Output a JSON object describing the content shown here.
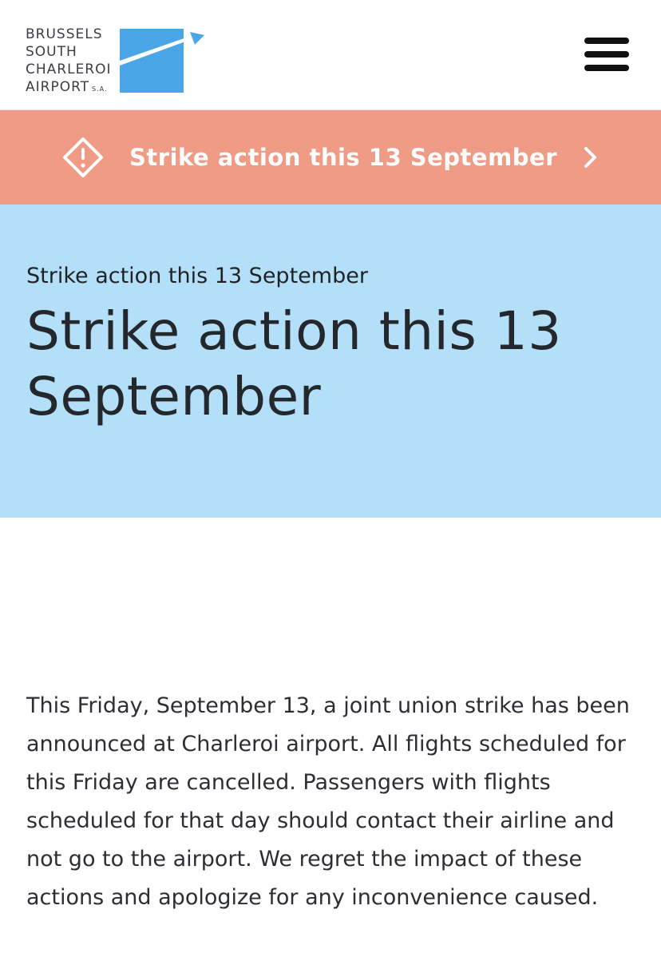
{
  "header": {
    "logo": {
      "lines": [
        "BRUSSELS",
        "SOUTH",
        "CHARLEROI",
        "AIRPORT"
      ],
      "suffix": "S.A."
    },
    "menu_icon": "hamburger-menu-icon"
  },
  "alert_banner": {
    "icon": "warning-diamond-icon",
    "text": "Strike action this 13 September",
    "chevron_icon": "chevron-right-icon",
    "color": "#ef9b86"
  },
  "hero": {
    "breadcrumb": "Strike action this 13 September",
    "title": "Strike action this 13 September",
    "background": "#b3e0f8"
  },
  "content": {
    "paragraph": "This Friday, September 13, a joint union strike has been announced at Charleroi airport. All flights scheduled for this Friday are cancelled. Passengers with flights scheduled for that day should contact their airline and not go to the airport. We regret the impact of these actions and apologize for any inconvenience caused."
  }
}
